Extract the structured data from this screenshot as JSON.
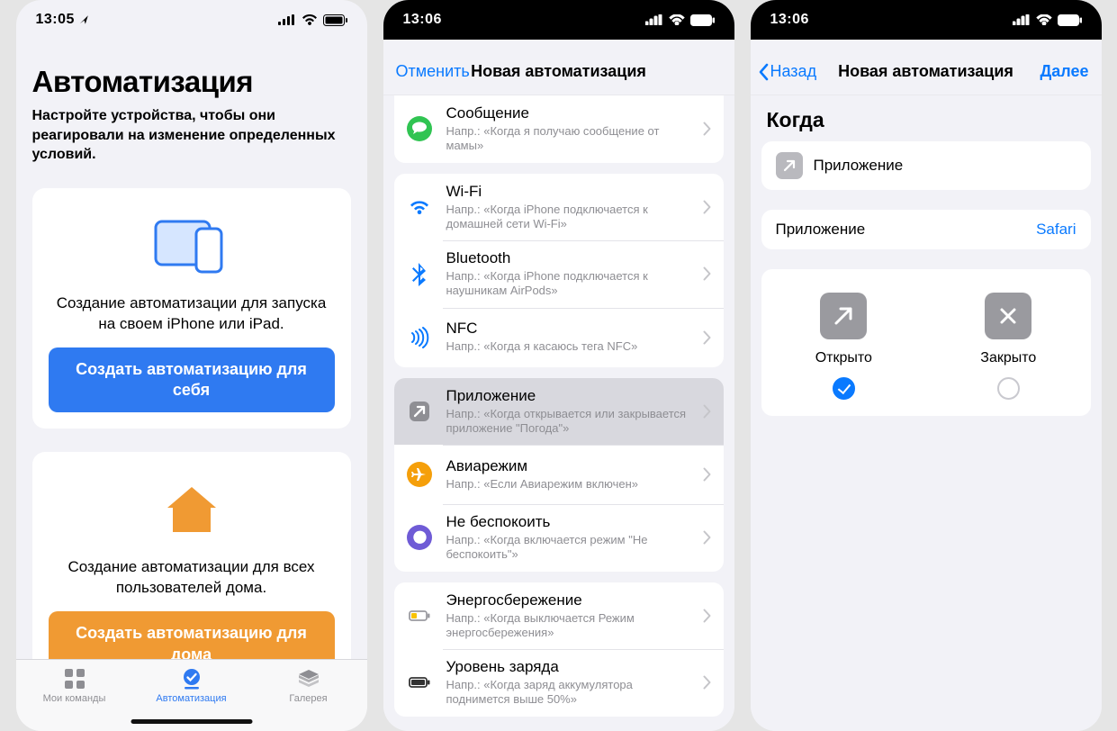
{
  "phone1": {
    "status_time": "13:05",
    "title": "Автоматизация",
    "subtitle": "Настройте устройства, чтобы они реагировали на изменение определенных условий.",
    "card_personal_text": "Создание автоматизации для запуска на своем iPhone или iPad.",
    "btn_personal": "Создать автоматизацию для себя",
    "card_home_text": "Создание автоматизации для всех пользователей дома.",
    "btn_home": "Создать автоматизацию для дома",
    "tabs": {
      "my": "Мои команды",
      "auto": "Автоматизация",
      "gallery": "Галерея"
    }
  },
  "phone2": {
    "status_time": "13:06",
    "nav_cancel": "Отменить",
    "nav_title": "Новая автоматизация",
    "groups": [
      [
        {
          "icon": "message",
          "title": "Сообщение",
          "sub": "Напр.: «Когда я получаю сообщение от мамы»"
        }
      ],
      [
        {
          "icon": "wifi",
          "title": "Wi-Fi",
          "sub": "Напр.: «Когда iPhone подключается к домашней сети Wi-Fi»"
        },
        {
          "icon": "bluetooth",
          "title": "Bluetooth",
          "sub": "Напр.: «Когда iPhone подключается к наушникам AirPods»"
        },
        {
          "icon": "nfc",
          "title": "NFC",
          "sub": "Напр.: «Когда я касаюсь тега NFC»"
        }
      ],
      [
        {
          "icon": "app",
          "title": "Приложение",
          "sub": "Напр.: «Когда открывается или закрывается приложение \"Погода\"»",
          "selected": true
        },
        {
          "icon": "airplane",
          "title": "Авиарежим",
          "sub": "Напр.: «Если Авиарежим включен»"
        },
        {
          "icon": "dnd",
          "title": "Не беспокоить",
          "sub": "Напр.: «Когда включается режим \"Не беспокоить\"»"
        }
      ],
      [
        {
          "icon": "lowpower",
          "title": "Энергосбережение",
          "sub": "Напр.: «Когда выключается Режим энергосбережения»"
        },
        {
          "icon": "battery",
          "title": "Уровень заряда",
          "sub": "Напр.: «Когда заряд аккумулятора поднимется выше 50%»"
        }
      ]
    ]
  },
  "phone3": {
    "status_time": "13:06",
    "nav_back": "Назад",
    "nav_title": "Новая автоматизация",
    "nav_next": "Далее",
    "section_when": "Когда",
    "row_app_label": "Приложение",
    "picker_label": "Приложение",
    "picker_value": "Safari",
    "opt_open": "Открыто",
    "opt_close": "Закрыто"
  }
}
